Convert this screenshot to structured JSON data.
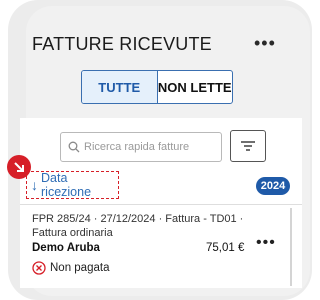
{
  "header": {
    "title": "FATTURE RICEVUTE",
    "more_label": "•••"
  },
  "filter_tabs": [
    {
      "label": "TUTTE",
      "active": true
    },
    {
      "label": "NON LETTE",
      "active": false
    }
  ],
  "search": {
    "placeholder": "Ricerca rapida fatture"
  },
  "sort": {
    "arrow": "↓",
    "label": "Data ricezione"
  },
  "year_badge": "2024",
  "invoice": {
    "meta": "FPR 285/24 · 27/12/2024 · Fattura - TD01 · Fattura ordinaria",
    "supplier": "Demo Aruba",
    "amount": "75,01 €",
    "more_label": "•••",
    "status": "Non pagata"
  },
  "colors": {
    "accent": "#1f5aa8",
    "highlight_red": "#d61f28"
  }
}
